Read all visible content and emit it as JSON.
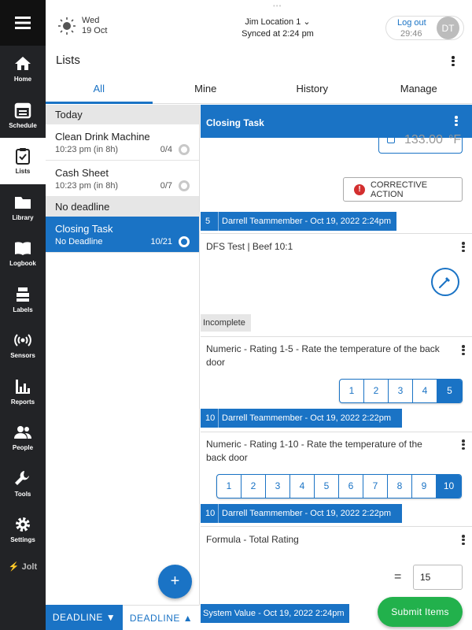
{
  "topbar": {
    "day": "Wed",
    "date": "19 Oct",
    "location": "Jim Location 1",
    "synced": "Synced at 2:24 pm",
    "logout_label": "Log out",
    "logout_time": "29:46",
    "avatar_initials": "DT"
  },
  "nav": {
    "items": [
      {
        "label": "Home",
        "icon": "home-icon"
      },
      {
        "label": "Schedule",
        "icon": "calendar-icon"
      },
      {
        "label": "Lists",
        "icon": "clipboard-check-icon"
      },
      {
        "label": "Library",
        "icon": "folder-icon"
      },
      {
        "label": "Logbook",
        "icon": "book-icon"
      },
      {
        "label": "Labels",
        "icon": "labels-icon"
      },
      {
        "label": "Sensors",
        "icon": "sensor-icon"
      },
      {
        "label": "Reports",
        "icon": "bar-chart-icon"
      },
      {
        "label": "People",
        "icon": "people-icon"
      },
      {
        "label": "Tools",
        "icon": "wrench-icon"
      },
      {
        "label": "Settings",
        "icon": "gear-icon"
      }
    ],
    "brand": "Jolt"
  },
  "page": {
    "title": "Lists"
  },
  "tabs": [
    "All",
    "Mine",
    "History",
    "Manage"
  ],
  "lists": {
    "sections": {
      "today": "Today",
      "no_deadline": "No deadline"
    },
    "items": [
      {
        "name": "Clean Drink Machine",
        "time": "10:23 pm (in 8h)",
        "count": "0/4"
      },
      {
        "name": "Cash Sheet",
        "time": "10:23 pm (in 8h)",
        "count": "0/7"
      },
      {
        "name": "Closing Task",
        "time": "No Deadline",
        "count": "10/21"
      }
    ],
    "fab_label": "+",
    "sort_desc": "DEADLINE ▼",
    "sort_asc": "DEADLINE ▲"
  },
  "detail": {
    "title": "Closing Task",
    "temperature": {
      "value": "133.00",
      "unit": "°F"
    },
    "corrective_label": "CORRECTIVE ACTION",
    "q1_meta": {
      "n": "5",
      "who": "Darrell Teammember - Oct 19, 2022 2:24pm"
    },
    "q2": {
      "title": "DFS Test | Beef 10:1",
      "status": "Incomplete"
    },
    "q3": {
      "title": "Numeric - Rating 1-5 - Rate the temperature of the back door",
      "options": [
        "1",
        "2",
        "3",
        "4",
        "5"
      ],
      "selected": "5",
      "meta_n": "10",
      "meta_who": "Darrell Teammember - Oct 19, 2022 2:22pm"
    },
    "q4": {
      "title": "Numeric - Rating 1-10 - Rate the temperature of the back door",
      "options": [
        "1",
        "2",
        "3",
        "4",
        "5",
        "6",
        "7",
        "8",
        "9",
        "10"
      ],
      "selected": "10",
      "meta_n": "10",
      "meta_who": "Darrell Teammember - Oct 19, 2022 2:22pm"
    },
    "q5": {
      "title": "Formula - Total Rating",
      "equals": "=",
      "value": "15",
      "meta": "System Value - Oct 19, 2022 2:24pm"
    },
    "submit_label": "Submit Items"
  },
  "colors": {
    "primary": "#1a73c5",
    "nav_bg": "#222326",
    "submit": "#22b14c",
    "alert": "#d32f2f"
  }
}
